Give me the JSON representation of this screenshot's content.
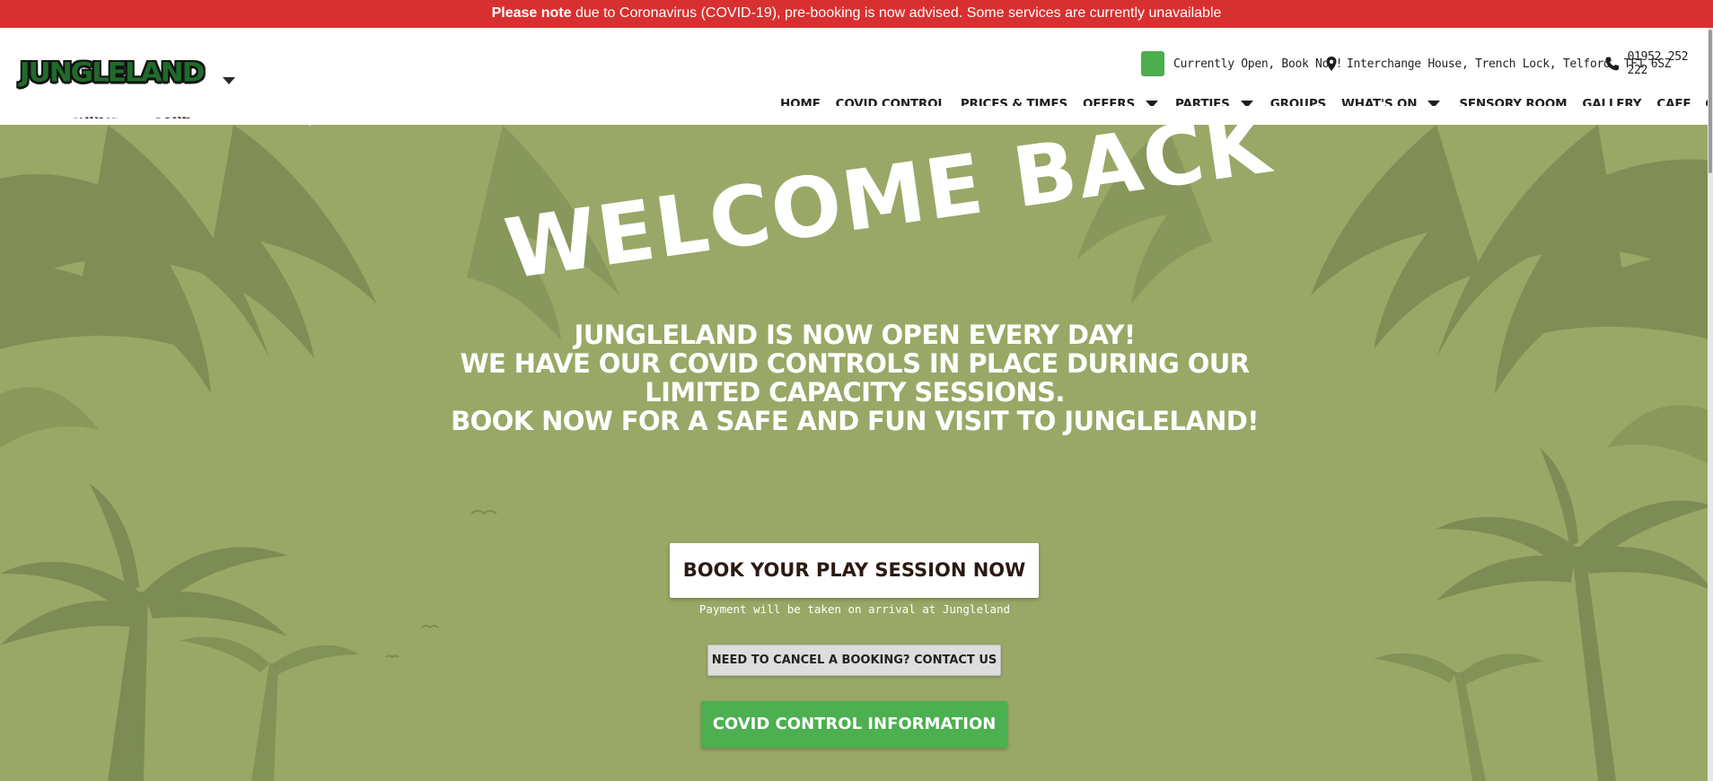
{
  "alert": {
    "bold": "Please note",
    "text": " due to Coronavirus (COVID-19), pre-booking is now advised. Some services are currently unavailable"
  },
  "logo": {
    "main": "JUNGLELAND",
    "sub": "A SAFARI ADVENTURE"
  },
  "header_info": {
    "status": "Currently Open, Book Now!",
    "address": "Interchange House, Trench Lock, Telford, TF1 6SZ",
    "phone": "01952 252 222",
    "status_color": "#4cae4c"
  },
  "nav": {
    "items": [
      {
        "label": "HOME"
      },
      {
        "label": "COVID CONTROL"
      },
      {
        "label": "PRICES & TIMES"
      },
      {
        "label": "OFFERS"
      },
      {
        "label": "PARTIES"
      },
      {
        "label": "GROUPS"
      },
      {
        "label": "WHAT'S ON"
      },
      {
        "label": "SENSORY ROOM"
      },
      {
        "label": "GALLERY"
      },
      {
        "label": "CAFE"
      },
      {
        "label": "CONTACT"
      }
    ]
  },
  "hero": {
    "welcome": "WELCOME BACK",
    "intro_lines": [
      "JUNGLELAND IS NOW OPEN EVERY DAY!",
      "WE HAVE OUR COVID CONTROLS IN PLACE DURING OUR",
      "LIMITED CAPACITY SESSIONS.",
      "BOOK NOW FOR A SAFE AND FUN VISIT TO JUNGLELAND!"
    ],
    "book_button": "BOOK YOUR PLAY SESSION NOW",
    "payment_note": "Payment will be taken on arrival at Jungleland",
    "cancel_button": "NEED TO CANCEL A BOOKING? CONTACT US",
    "covid_button": "COVID CONTROL INFORMATION"
  },
  "colors": {
    "alert_bg": "#d83030",
    "hero_bg": "#99a866",
    "foliage": "#7d8c54",
    "accent_green": "#4caf50",
    "logo_green": "#1f6b2a"
  },
  "icons": {
    "logo_dropdown": "chevron-down-icon",
    "address": "map-pin-icon",
    "phone": "phone-icon",
    "nav_dropdown": "chevron-down-icon"
  }
}
